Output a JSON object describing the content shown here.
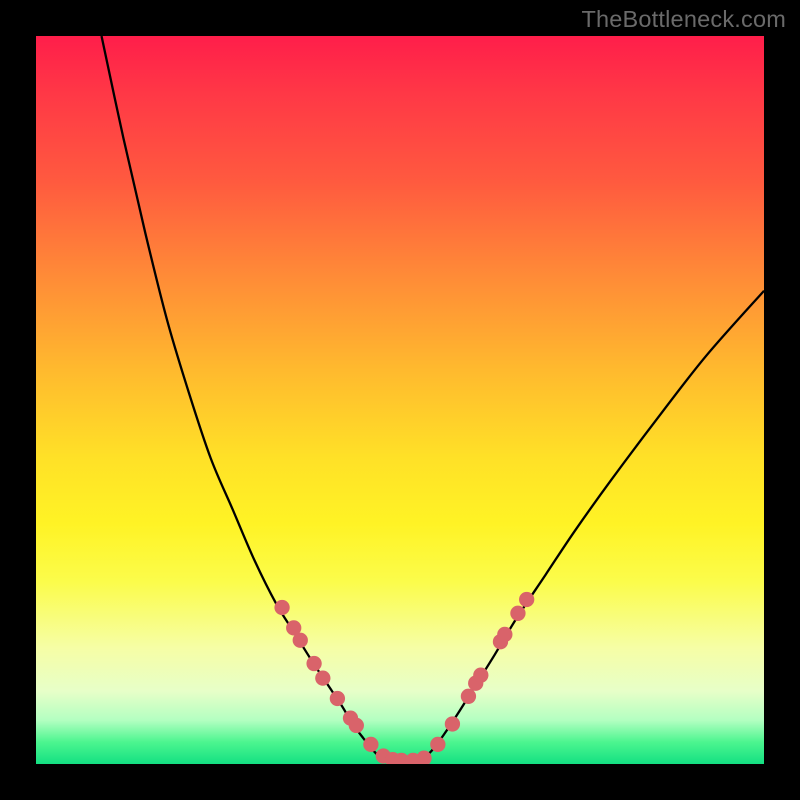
{
  "watermark": "TheBottleneck.com",
  "chart_data": {
    "type": "line",
    "title": "",
    "xlabel": "",
    "ylabel": "",
    "xlim": [
      0,
      100
    ],
    "ylim": [
      0,
      100
    ],
    "grid": false,
    "legend": false,
    "series": [
      {
        "name": "left-curve",
        "x": [
          9,
          12,
          15,
          18,
          21,
          24,
          27,
          30,
          33,
          35.5,
          38,
          40,
          42,
          43.5,
          45,
          46.2,
          47.2,
          48
        ],
        "y": [
          100,
          86,
          73,
          61,
          51,
          42,
          35,
          28,
          22,
          18,
          14,
          11,
          8,
          5.5,
          3.5,
          2,
          1,
          0.5
        ]
      },
      {
        "name": "bottom-flat",
        "x": [
          48,
          49,
          50,
          51,
          52,
          53
        ],
        "y": [
          0.5,
          0.3,
          0.3,
          0.3,
          0.3,
          0.5
        ]
      },
      {
        "name": "right-curve",
        "x": [
          53,
          54.5,
          56,
          58,
          60.5,
          63,
          66,
          70,
          74,
          79,
          85,
          92,
          100
        ],
        "y": [
          0.5,
          2,
          4,
          7,
          11,
          15,
          20,
          26,
          32,
          39,
          47,
          56,
          65
        ]
      }
    ],
    "markers": {
      "name": "dots",
      "points": [
        {
          "x": 33.8,
          "y": 21.5
        },
        {
          "x": 35.4,
          "y": 18.7
        },
        {
          "x": 36.3,
          "y": 17.0
        },
        {
          "x": 38.2,
          "y": 13.8
        },
        {
          "x": 39.4,
          "y": 11.8
        },
        {
          "x": 41.4,
          "y": 9.0
        },
        {
          "x": 43.2,
          "y": 6.3
        },
        {
          "x": 44.0,
          "y": 5.3
        },
        {
          "x": 46.0,
          "y": 2.7
        },
        {
          "x": 47.7,
          "y": 1.1
        },
        {
          "x": 49.0,
          "y": 0.6
        },
        {
          "x": 50.2,
          "y": 0.5
        },
        {
          "x": 51.8,
          "y": 0.5
        },
        {
          "x": 53.3,
          "y": 0.8
        },
        {
          "x": 55.2,
          "y": 2.7
        },
        {
          "x": 57.2,
          "y": 5.5
        },
        {
          "x": 59.4,
          "y": 9.3
        },
        {
          "x": 60.4,
          "y": 11.1
        },
        {
          "x": 61.1,
          "y": 12.2
        },
        {
          "x": 63.8,
          "y": 16.8
        },
        {
          "x": 64.4,
          "y": 17.8
        },
        {
          "x": 66.2,
          "y": 20.7
        },
        {
          "x": 67.4,
          "y": 22.6
        }
      ]
    },
    "colors": {
      "line": "#000000",
      "marker": "#d9636a"
    }
  }
}
